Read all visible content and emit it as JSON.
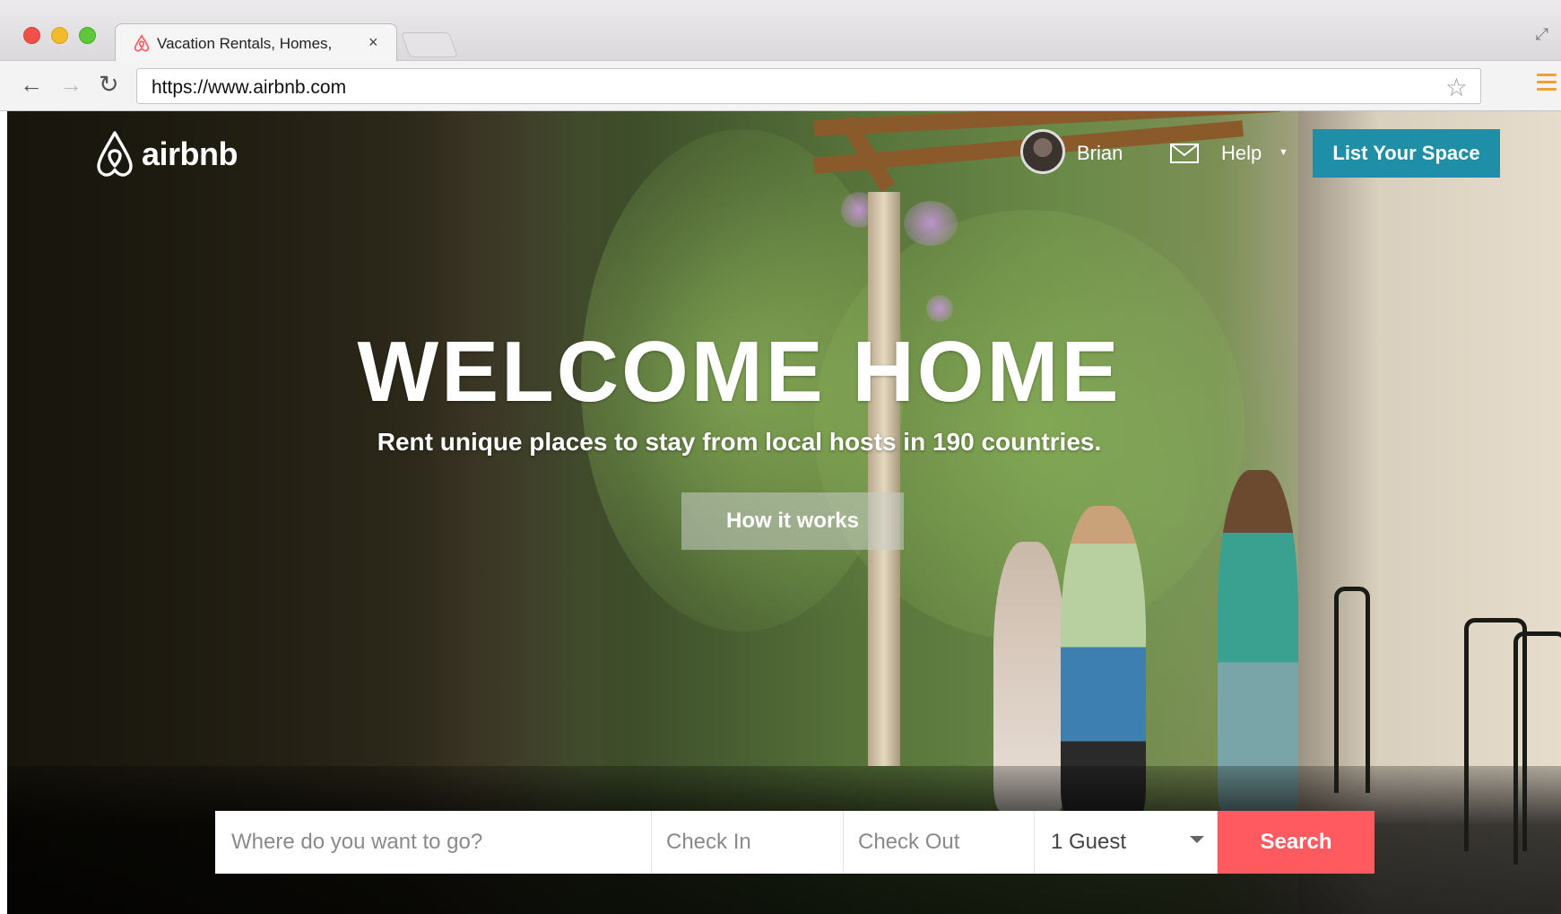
{
  "browser": {
    "tab": {
      "title": "Vacation Rentals, Homes, ",
      "close": "×",
      "favicon": "airbnb-logo-icon"
    },
    "address": {
      "url": "https://www.airbnb.com"
    },
    "icons": {
      "back": "arrow-left-icon",
      "forward": "arrow-right-icon",
      "reload": "reload-icon",
      "bookmark": "star-icon",
      "menu": "hamburger-menu-icon",
      "fullscreen": "fullscreen-icon"
    }
  },
  "header": {
    "logo_text": "airbnb",
    "user_name": "Brian",
    "help": "Help",
    "list_space": "List Your Space"
  },
  "hero": {
    "title": "WELCOME HOME",
    "subtitle": "Rent unique places to stay from local hosts in 190 countries.",
    "how_it_works": "How it works"
  },
  "search": {
    "where_placeholder": "Where do you want to go?",
    "check_in": "Check In",
    "check_out": "Check Out",
    "guests": "1 Guest",
    "button": "Search"
  },
  "colors": {
    "brand_red": "#ff5a5f",
    "list_space_teal": "#1e8fa6"
  }
}
